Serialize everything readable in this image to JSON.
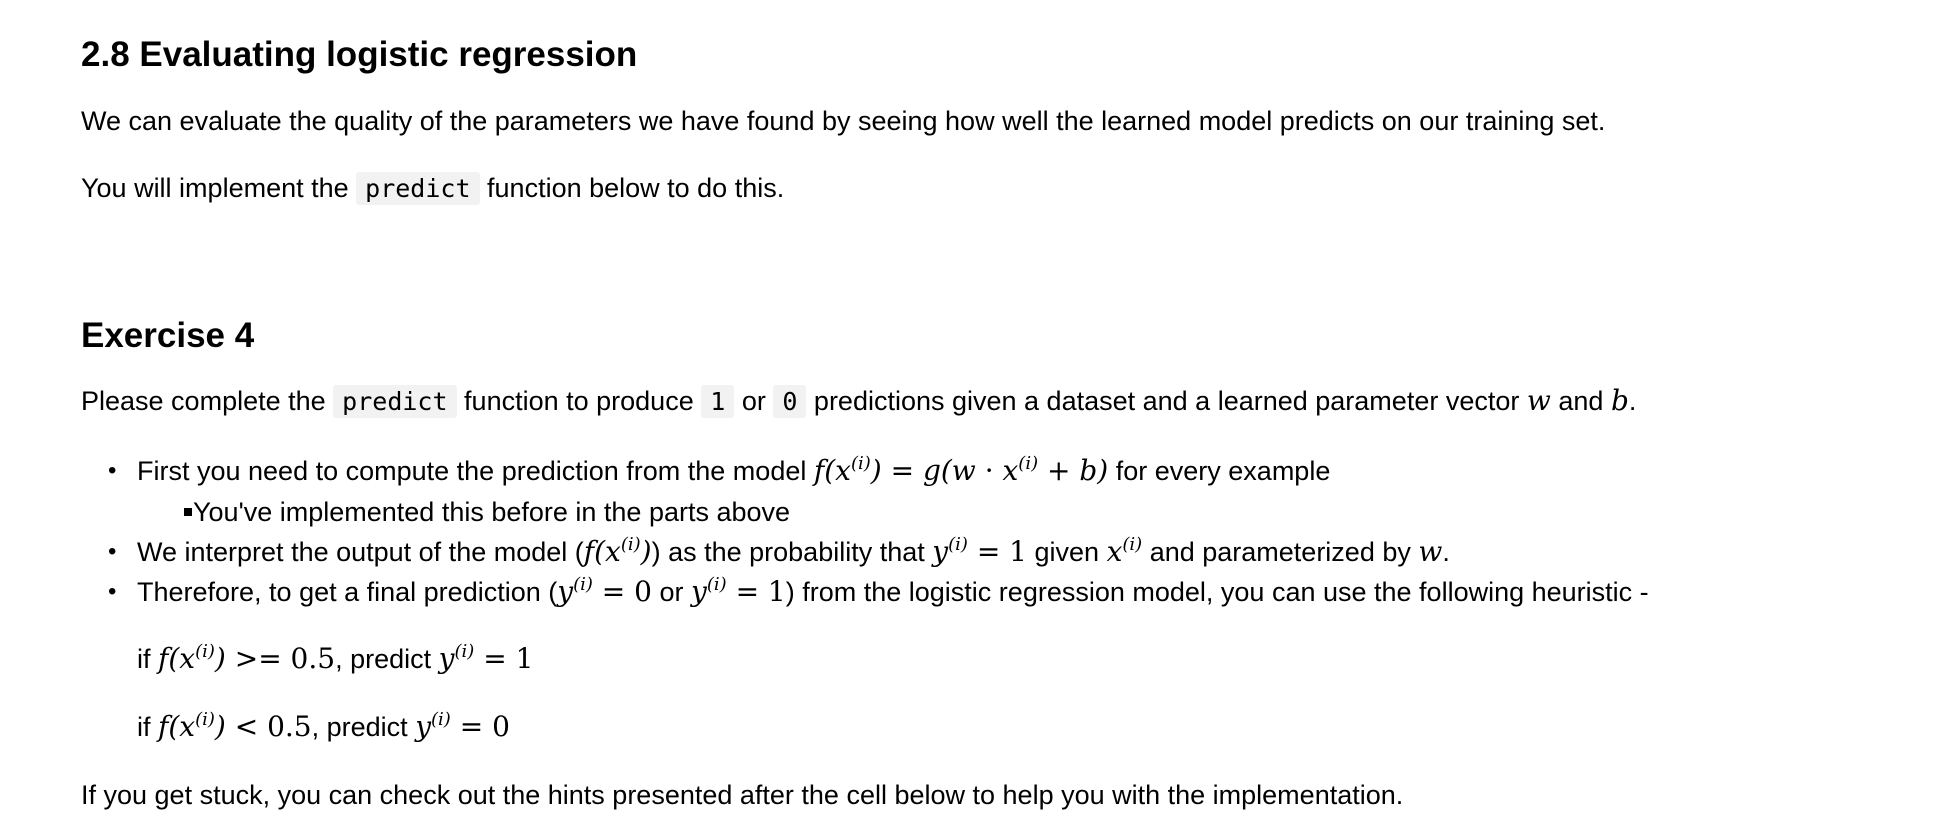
{
  "section": {
    "title": "2.8 Evaluating logistic regression",
    "intro": "We can evaluate the quality of the parameters we have found by seeing how well the learned model predicts on our training set.",
    "implement_pre": "You will implement the",
    "implement_code": "predict",
    "implement_post": "function below to do this."
  },
  "exercise": {
    "title": "Exercise 4",
    "desc_pre": "Please complete the",
    "desc_code": "predict",
    "desc_mid1": "function to produce",
    "desc_code_one": "1",
    "desc_or": "or",
    "desc_code_zero": "0",
    "desc_mid2": "predictions given a dataset and a learned parameter vector",
    "desc_w": "w",
    "desc_and": "and",
    "desc_b": "b",
    "desc_end": ".",
    "bullets": [
      {
        "pre": "First you need to compute the prediction from the model",
        "math": "f(x⁽ⁱ⁾) = g(w · x⁽ⁱ⁾ + b)",
        "post": "for every example"
      },
      {
        "pre": "You've implemented this before in the parts above"
      },
      {
        "pre": "We interpret the output of the model (",
        "math": "f(x⁽ⁱ⁾)",
        "mid": ") as the probability that",
        "math2": "y⁽ⁱ⁾ = 1",
        "mid2": "given",
        "math3": "x⁽ⁱ⁾",
        "post": "and parameterized by",
        "math4": "w",
        "end": "."
      },
      {
        "pre": "Therefore, to get a final prediction (",
        "math": "y⁽ⁱ⁾ = 0",
        "mid": "or",
        "math2": "y⁽ⁱ⁾ = 1",
        "post": ") from the logistic regression model, you can use the following heuristic -"
      }
    ],
    "conditions": [
      {
        "if": "if",
        "lhs": "f(x⁽ⁱ⁾) >= 0.5",
        "predict": ", predict",
        "rhs": "y⁽ⁱ⁾ = 1"
      },
      {
        "if": "if",
        "lhs": "f(x⁽ⁱ⁾) < 0.5",
        "predict": ", predict",
        "rhs": "y⁽ⁱ⁾ = 0"
      }
    ],
    "hint": "If you get stuck, you can check out the hints presented after the cell below to help you with the implementation."
  }
}
